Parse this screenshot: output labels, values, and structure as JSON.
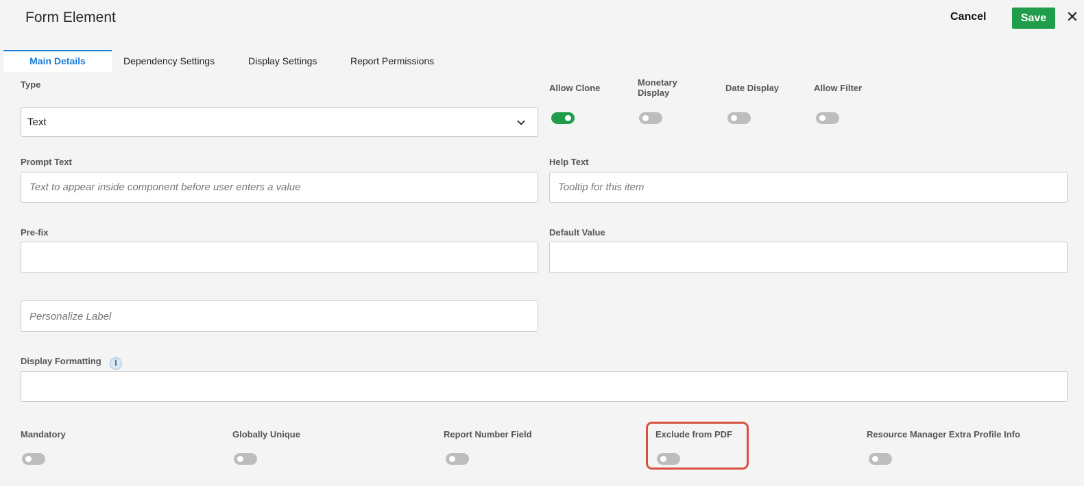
{
  "header": {
    "title": "Form Element",
    "cancel_label": "Cancel",
    "save_label": "Save",
    "close_glyph": "✕"
  },
  "tabs": [
    {
      "label": "Main Details",
      "active": true
    },
    {
      "label": "Dependency Settings",
      "active": false
    },
    {
      "label": "Display Settings",
      "active": false
    },
    {
      "label": "Report Permissions",
      "active": false
    }
  ],
  "form": {
    "type": {
      "label": "Type",
      "value": "Text"
    },
    "top_toggles": [
      {
        "label": "Allow Clone",
        "on": true
      },
      {
        "label": "Monetary Display",
        "on": false
      },
      {
        "label": "Date Display",
        "on": false
      },
      {
        "label": "Allow Filter",
        "on": false
      }
    ],
    "prompt_text": {
      "label": "Prompt Text",
      "placeholder": "Text to appear inside component before user enters a value",
      "value": ""
    },
    "help_text": {
      "label": "Help Text",
      "placeholder": "Tooltip for this item",
      "value": ""
    },
    "prefix": {
      "label": "Pre-fix",
      "value": ""
    },
    "default_value": {
      "label": "Default Value",
      "value": ""
    },
    "personalize_label": {
      "placeholder": "Personalize Label",
      "value": ""
    },
    "display_formatting": {
      "label": "Display Formatting",
      "info_glyph": "i",
      "value": ""
    },
    "bottom_toggles": [
      {
        "label": "Mandatory",
        "on": false
      },
      {
        "label": "Globally Unique",
        "on": false
      },
      {
        "label": "Report Number Field",
        "on": false
      },
      {
        "label": "Exclude from PDF",
        "on": false
      },
      {
        "label": "Resource Manager Extra Profile Info",
        "on": false
      }
    ]
  },
  "colors": {
    "accent": "#1a7fd6",
    "save_green": "#1f9d4a",
    "highlight_red": "#d9503f",
    "toggle_off": "#bdbdbd"
  }
}
